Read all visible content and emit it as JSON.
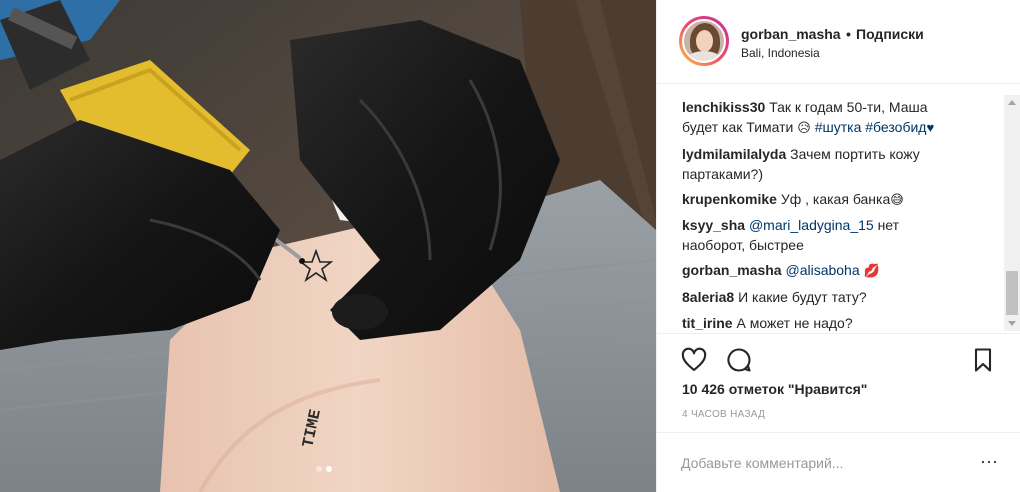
{
  "post": {
    "username": "gorban_masha",
    "separator": "•",
    "follow_label": "Подписки",
    "location": "Bali, Indonesia",
    "image_label": "TIME",
    "carousel": {
      "count": 2,
      "active_index": 1
    }
  },
  "comments": [
    {
      "author": "lenchikiss30",
      "text_1": "Так к годам 50-ти, Маша",
      "text_2": "будет как Тимати",
      "emoji_1": "😥",
      "tag_1": "#шутка",
      "tag_2": "#безобид",
      "emoji_2": "♥"
    },
    {
      "author": "lydmilamilalyda",
      "text_1": "Зачем портить кожу",
      "text_2": "партаками?)"
    },
    {
      "author": "krupenkomike",
      "text_1": "Уф , какая банка",
      "emoji_1": "😅"
    },
    {
      "author": "ksyy_sha",
      "mention": "@mari_ladygina_15",
      "text_1": "нет",
      "text_2": "наоборот, быстрее"
    },
    {
      "author": "gorban_masha",
      "mention": "@alisaboha",
      "emoji_1": "💋"
    },
    {
      "author": "8aleria8",
      "text_1": "И какие будут тату?"
    },
    {
      "author": "tit_irine",
      "text_1": "А может не надо?"
    }
  ],
  "actions": {
    "like_icon": "heart-outline-icon",
    "comment_icon": "speech-bubble-icon",
    "save_icon": "bookmark-icon"
  },
  "likes_text": "10 426 отметок \"Нравится\"",
  "timestamp": "4 часов назад",
  "comment_input": {
    "placeholder": "Добавьте комментарий...",
    "value": "",
    "more_label": "···"
  },
  "colors": {
    "text": "#262626",
    "link": "#003569",
    "muted": "#999999",
    "border": "#efefef",
    "story_ring_start": "#f9c441",
    "story_ring_end": "#c72c9f"
  }
}
